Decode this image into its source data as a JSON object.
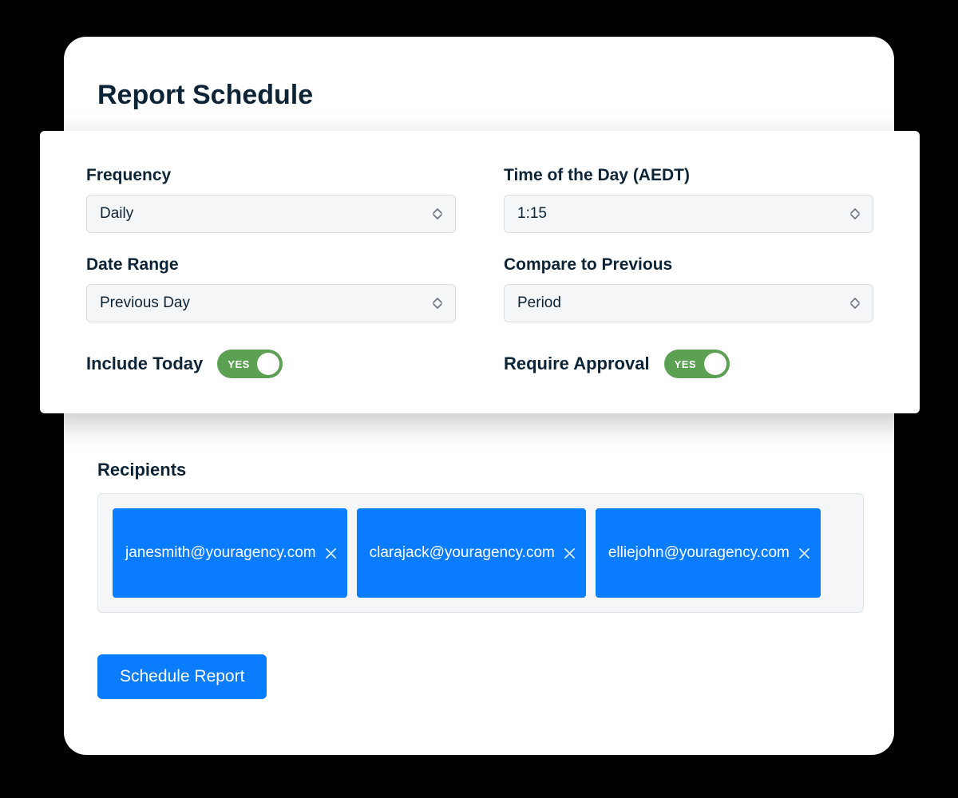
{
  "title": "Report Schedule",
  "fields": {
    "frequency": {
      "label": "Frequency",
      "value": "Daily"
    },
    "time_of_day": {
      "label": "Time of the Day (AEDT)",
      "value": "1:15"
    },
    "date_range": {
      "label": "Date Range",
      "value": "Previous Day"
    },
    "compare": {
      "label": "Compare to Previous",
      "value": "Period"
    }
  },
  "toggles": {
    "include_today": {
      "label": "Include Today",
      "state_text": "YES"
    },
    "require_approval": {
      "label": "Require Approval",
      "state_text": "YES"
    }
  },
  "recipients": {
    "label": "Recipients",
    "items": [
      "janesmith@youragency.com",
      "clarajack@youragency.com",
      "elliejohn@youragency.com"
    ]
  },
  "actions": {
    "schedule": "Schedule Report"
  }
}
